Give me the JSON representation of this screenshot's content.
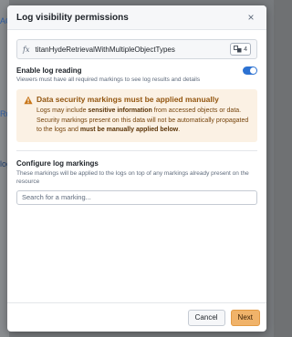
{
  "background": {
    "fragments": [
      "AG",
      "Ru",
      "log"
    ]
  },
  "dialog": {
    "title": "Log visibility permissions",
    "close_symbol": "×"
  },
  "function_field": {
    "icon": "fx",
    "name": "titanHydeRetrievalWithMultipleObjectTypes",
    "badge_count": "4",
    "badge_icon": "object-types-icon"
  },
  "enable_log_reading": {
    "label": "Enable log reading",
    "help": "Viewers must have all required markings to see log results and details",
    "enabled": true
  },
  "callout": {
    "title": "Data security markings must be applied manually",
    "text_1": "Logs may include ",
    "bold_1": "sensitive information",
    "text_2": " from accessed objects or data. Security markings present on this data will not be automatically propagated to the logs and ",
    "bold_2": "must be manually applied below",
    "text_3": ".",
    "color": "#935610",
    "background": "#fbf1e4"
  },
  "markings": {
    "title": "Configure log markings",
    "help": "These markings will be applied to the logs on top of any markings already present on the resource",
    "search_placeholder": "Search for a marking...",
    "search_value": ""
  },
  "footer": {
    "cancel_label": "Cancel",
    "next_label": "Next",
    "primary_color": "#f0b36a"
  }
}
